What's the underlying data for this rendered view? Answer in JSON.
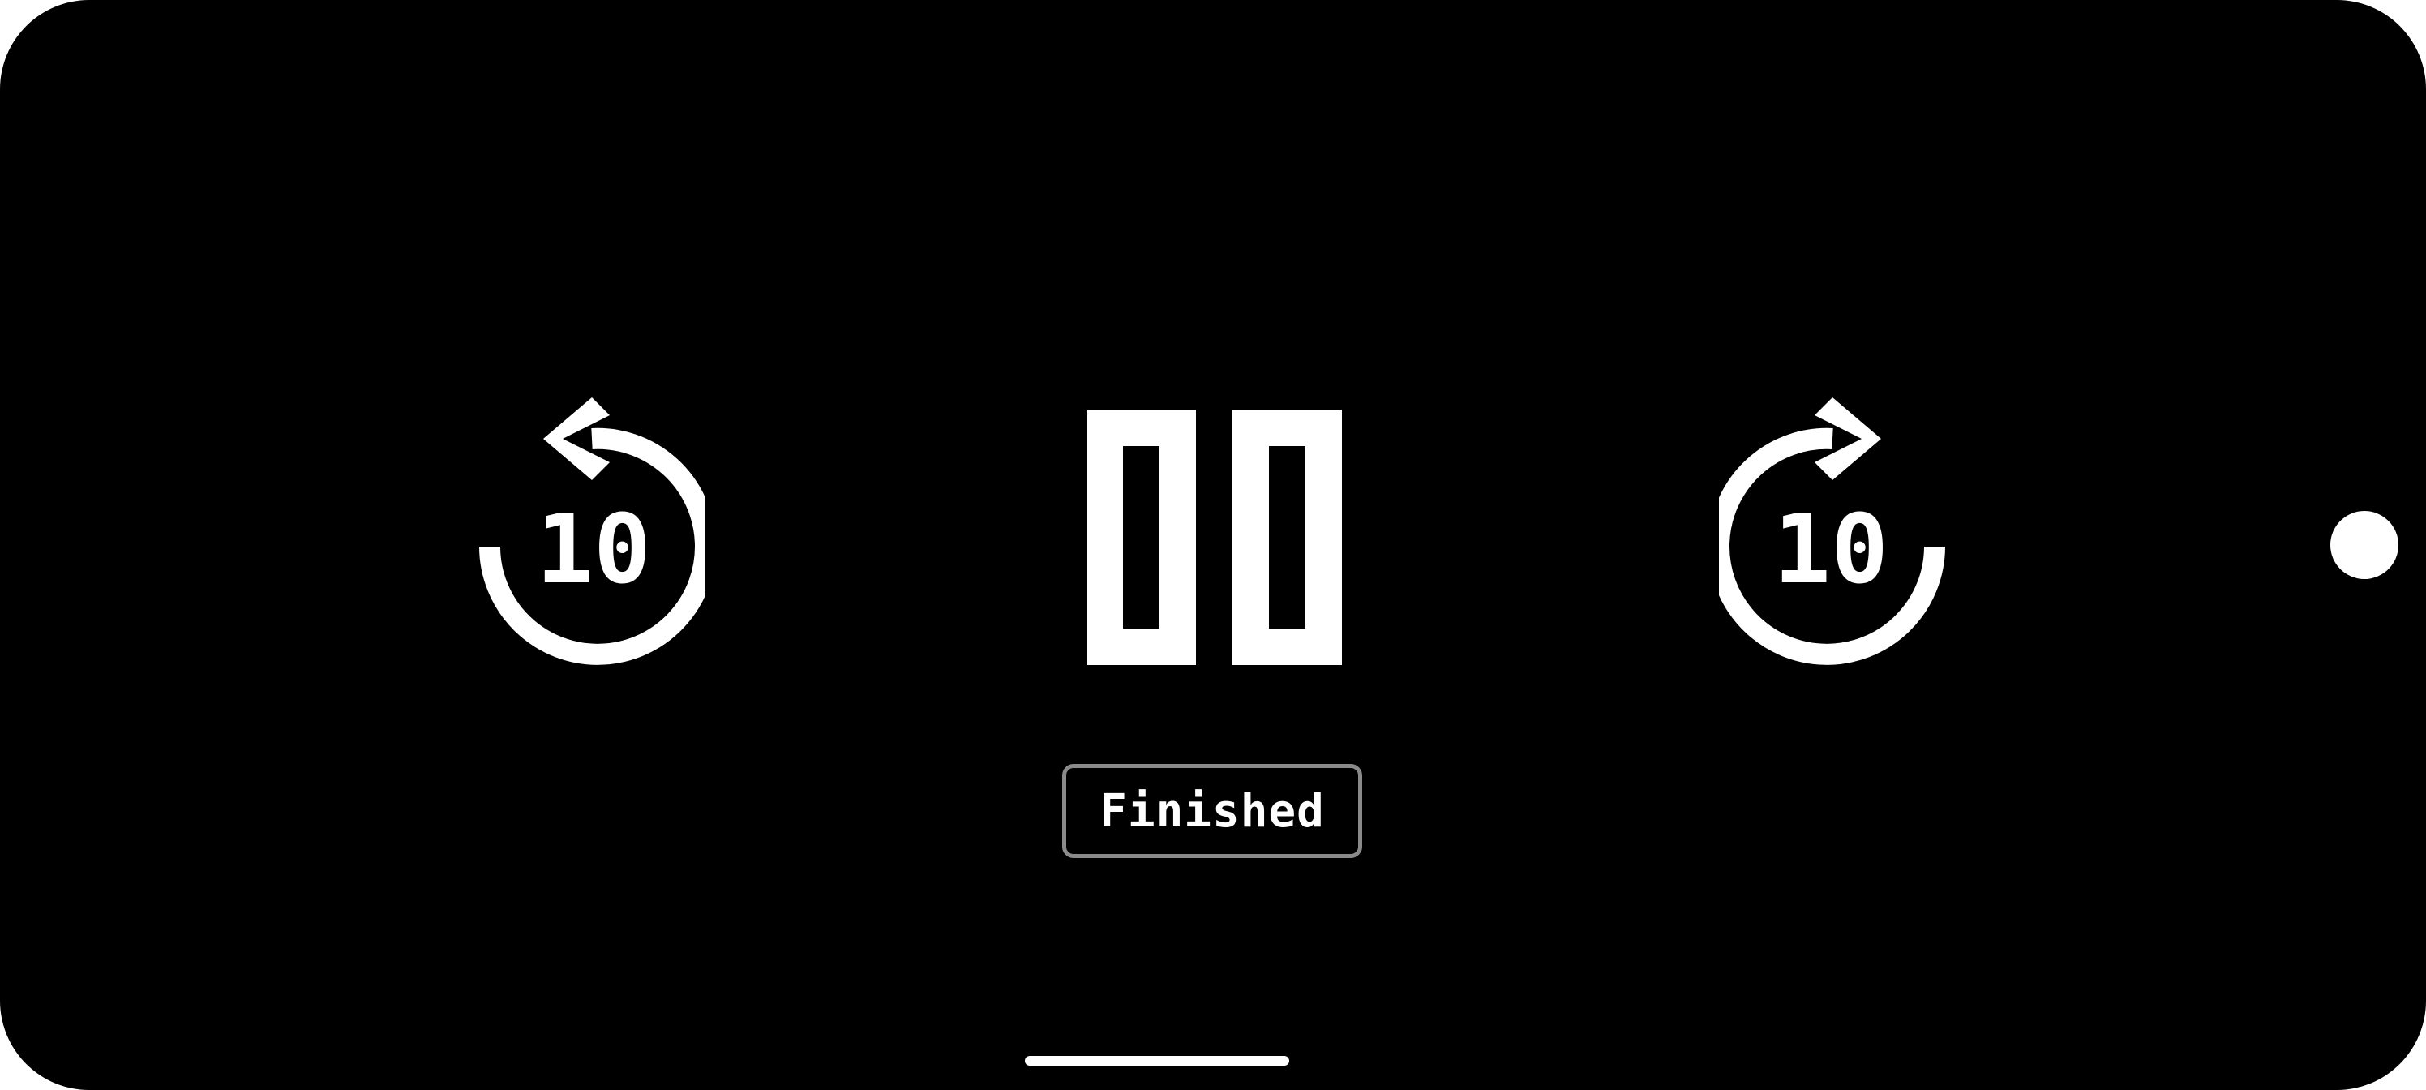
{
  "player": {
    "rewind": {
      "amount_label": "10",
      "icon": "replay-10-icon"
    },
    "playback": {
      "state": "paused",
      "icon": "pause-icon"
    },
    "forward": {
      "amount_label": "10",
      "icon": "forward-10-icon"
    },
    "status_label": "Finished"
  },
  "colors": {
    "background": "#000000",
    "foreground": "#ffffff",
    "status_border": "#8a8a8a"
  }
}
